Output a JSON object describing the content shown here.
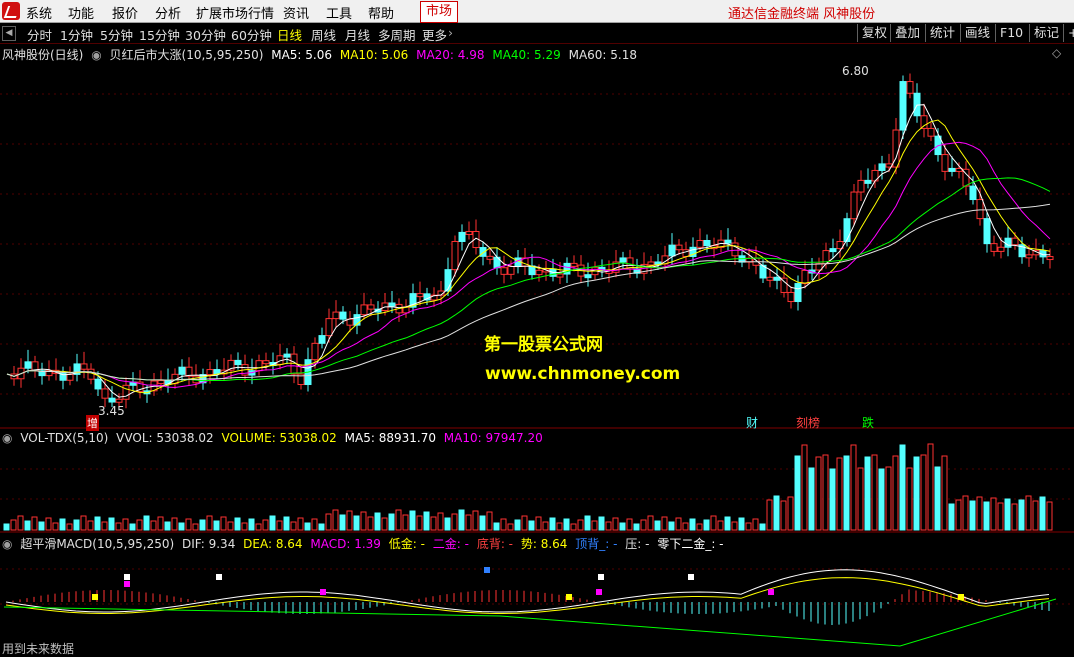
{
  "menu": {
    "items": [
      "系统",
      "功能",
      "报价",
      "分析",
      "扩展市场行情",
      "资讯",
      "工具",
      "帮助"
    ],
    "market_tab": "市场",
    "brand_title": "通达信金融终端  风神股份"
  },
  "toolbar": {
    "periods": [
      "分时",
      "1分钟",
      "5分钟",
      "15分钟",
      "30分钟",
      "60分钟",
      "日线",
      "周线",
      "月线",
      "多周期",
      "更多"
    ],
    "active_period": "日线",
    "right_buttons": [
      "复权",
      "叠加",
      "统计",
      "画线",
      "F10",
      "标记",
      "+"
    ]
  },
  "main_legend": {
    "stock": "风神股份(日线)",
    "indicator": "贝红后市大涨(10,5,95,250)",
    "ma5": "MA5: 5.06",
    "ma10": "MA10: 5.06",
    "ma20": "MA20: 4.98",
    "ma40": "MA40: 5.29",
    "ma60": "MA60: 5.18"
  },
  "price_labels": {
    "high": "6.80",
    "low": "3.45"
  },
  "markers": {
    "zeng": "增",
    "cai": "财",
    "bang": "刻榜",
    "die": "跌"
  },
  "watermark": {
    "line1": "第一股票公式网",
    "line2": "www.chnmoney.com"
  },
  "vol_legend": {
    "name": "VOL-TDX(5,10)",
    "vvol": "VVOL: 53038.02",
    "volume": "VOLUME: 53038.02",
    "ma5": "MA5: 88931.70",
    "ma10": "MA10: 97947.20"
  },
  "macd_legend": {
    "name": "超平滑MACD(10,5,95,250)",
    "dif": "DIF: 9.34",
    "dea": "DEA: 8.64",
    "macd": "MACD: 1.39",
    "low_gold": "低金: -",
    "second_gold": "二金: -",
    "bottom_div": "底背: -",
    "trend": "势: 8.64",
    "top_div": "顶背_: -",
    "press": "压: -",
    "below_zero": "零下二金_: -"
  },
  "status": {
    "bottom": "用到未来数据"
  },
  "colors": {
    "up": "#ff3232",
    "down": "#54ffff",
    "ma5": "#ffffff",
    "ma10": "#ffff00",
    "ma20": "#ff00ff",
    "ma40": "#00ff00",
    "ma60": "#e0e0e0",
    "watermark1": "#ffff00",
    "watermark2": "#ffff00"
  }
}
